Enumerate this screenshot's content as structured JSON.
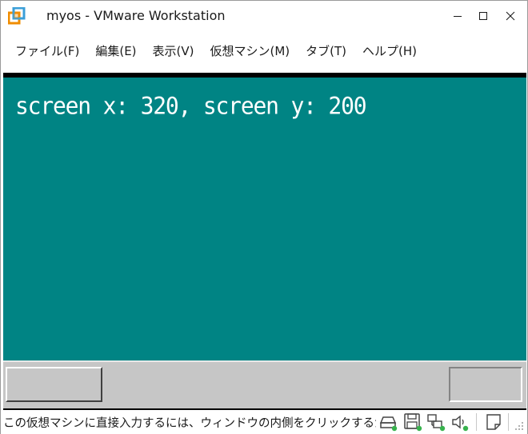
{
  "window": {
    "title": "myos - VMware Workstation"
  },
  "menu": {
    "items": [
      {
        "label": "ファイル(F)",
        "name": "menu-file"
      },
      {
        "label": "編集(E)",
        "name": "menu-edit"
      },
      {
        "label": "表示(V)",
        "name": "menu-view"
      },
      {
        "label": "仮想マシン(M)",
        "name": "menu-vm"
      },
      {
        "label": "タブ(T)",
        "name": "menu-tab"
      },
      {
        "label": "ヘルプ(H)",
        "name": "menu-help"
      }
    ]
  },
  "vm": {
    "screen_text": "screen x: 320, screen y: 200",
    "background_color": "#008484"
  },
  "statusbar": {
    "message": "この仮想マシンに直接入力するには、ウィンドウの内側をクリックするか Ctrl+G を押します。",
    "icons": [
      "hard-disk-icon",
      "floppy-disk-icon",
      "network-adapter-icon",
      "sound-card-icon",
      "message-log-icon"
    ]
  },
  "colors": {
    "vm_background": "#008484",
    "device_active_dot": "#37b24d",
    "vmware_orange": "#f08c00",
    "vmware_blue": "#3b9fd8"
  }
}
